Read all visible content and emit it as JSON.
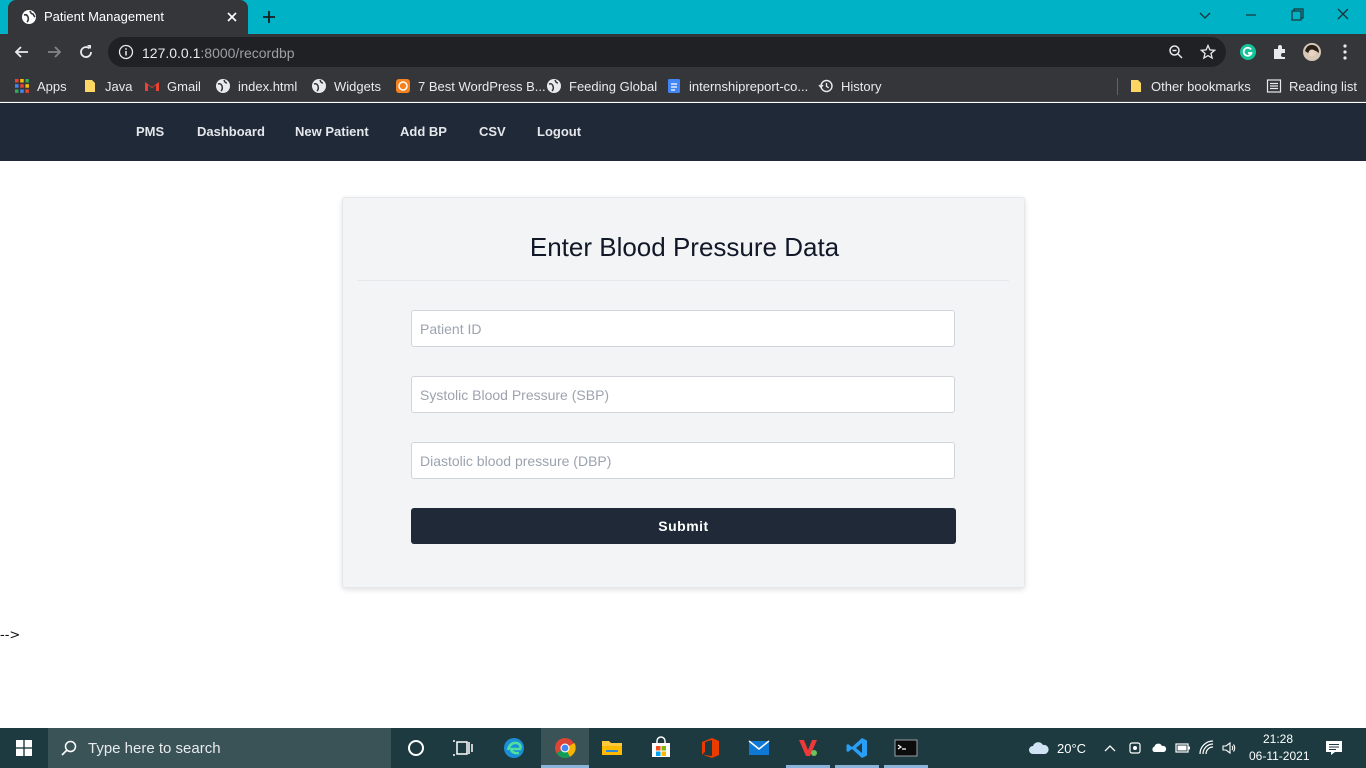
{
  "browser": {
    "tab_title": "Patient Management",
    "url_host": "127.0.0.1",
    "url_rest": ":8000/recordbp",
    "bookmarks": [
      {
        "label": "Apps",
        "icon": "apps-grid-icon"
      },
      {
        "label": "Java",
        "icon": "folder-icon"
      },
      {
        "label": "Gmail",
        "icon": "gmail-icon"
      },
      {
        "label": "index.html",
        "icon": "globe-icon"
      },
      {
        "label": "Widgets",
        "icon": "globe-icon"
      },
      {
        "label": "7 Best WordPress B...",
        "icon": "site-favicon-icon"
      },
      {
        "label": "Feeding Global",
        "icon": "globe-icon"
      },
      {
        "label": "internshipreport-co...",
        "icon": "docs-icon"
      },
      {
        "label": "History",
        "icon": "history-icon"
      }
    ],
    "other_bookmarks": "Other bookmarks",
    "reading_list": "Reading list"
  },
  "navbar": {
    "brand": "PMS",
    "links": [
      "Dashboard",
      "New Patient",
      "Add BP",
      "CSV",
      "Logout"
    ]
  },
  "form": {
    "title": "Enter Blood Pressure Data",
    "patient_id_placeholder": "Patient ID",
    "sbp_placeholder": "Systolic Blood Pressure (SBP)",
    "dbp_placeholder": "Diastolic blood pressure (DBP)",
    "submit_label": "Submit"
  },
  "stray_text": "-->",
  "taskbar": {
    "search_placeholder": "Type here to search",
    "temperature": "20°C",
    "time": "21:28",
    "date": "06-11-2021"
  },
  "colors": {
    "tabstrip": "#00b2c6",
    "navbar": "#1f2937",
    "submit": "#1f2937",
    "card": "#f3f4f6"
  }
}
